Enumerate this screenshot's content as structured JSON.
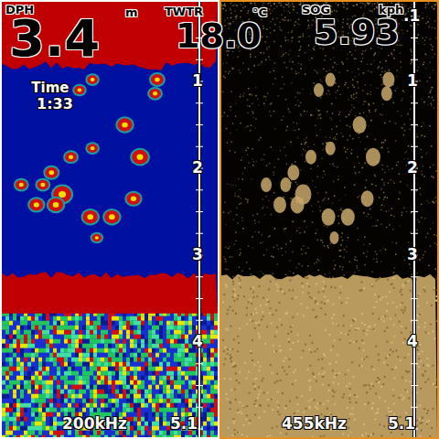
{
  "readouts": [
    {
      "label": "DPH",
      "value": "3.4",
      "unit": "m"
    },
    {
      "label": "TWTR",
      "value": "18.0",
      "unit": "°C"
    },
    {
      "label": "SOG",
      "value": "5.93",
      "unit": "kph"
    }
  ],
  "timer": {
    "label": "Time",
    "value": "1:33"
  },
  "bottom_depth": 3.25,
  "echoes": [
    {
      "x": 0.72,
      "depth": 0.98,
      "strength": 0.5
    },
    {
      "x": 0.71,
      "depth": 1.14,
      "strength": 0.4
    },
    {
      "x": 0.42,
      "depth": 0.98,
      "strength": 0.3
    },
    {
      "x": 0.36,
      "depth": 1.1,
      "strength": 0.3
    },
    {
      "x": 0.57,
      "depth": 1.5,
      "strength": 0.7
    },
    {
      "x": 0.42,
      "depth": 1.77,
      "strength": 0.3
    },
    {
      "x": 0.32,
      "depth": 1.87,
      "strength": 0.4
    },
    {
      "x": 0.64,
      "depth": 1.87,
      "strength": 0.8
    },
    {
      "x": 0.23,
      "depth": 2.05,
      "strength": 0.5
    },
    {
      "x": 0.19,
      "depth": 2.19,
      "strength": 0.4
    },
    {
      "x": 0.28,
      "depth": 2.3,
      "strength": 1.0
    },
    {
      "x": 0.25,
      "depth": 2.42,
      "strength": 0.7
    },
    {
      "x": 0.16,
      "depth": 2.42,
      "strength": 0.6
    },
    {
      "x": 0.51,
      "depth": 2.56,
      "strength": 0.7
    },
    {
      "x": 0.41,
      "depth": 2.56,
      "strength": 0.7
    },
    {
      "x": 0.61,
      "depth": 2.35,
      "strength": 0.6
    },
    {
      "x": 0.09,
      "depth": 2.19,
      "strength": 0.4
    },
    {
      "x": 0.44,
      "depth": 2.8,
      "strength": 0.2
    }
  ],
  "panels": [
    {
      "kind": "color",
      "frequency": "200kHz",
      "range": "5.1",
      "scale": [
        {
          "text": "1",
          "depth": 1
        },
        {
          "text": "2",
          "depth": 2
        },
        {
          "text": "3",
          "depth": 3
        },
        {
          "text": "4",
          "depth": 4
        }
      ],
      "show_timer": true
    },
    {
      "kind": "sepia",
      "frequency": "455kHz",
      "range": "5.1",
      "scale": [
        {
          "text": ".1",
          "depth": 0.25
        },
        {
          "text": "1",
          "depth": 1
        },
        {
          "text": "2",
          "depth": 2
        },
        {
          "text": "3",
          "depth": 3
        },
        {
          "text": "4",
          "depth": 4
        }
      ],
      "show_timer": false
    }
  ]
}
